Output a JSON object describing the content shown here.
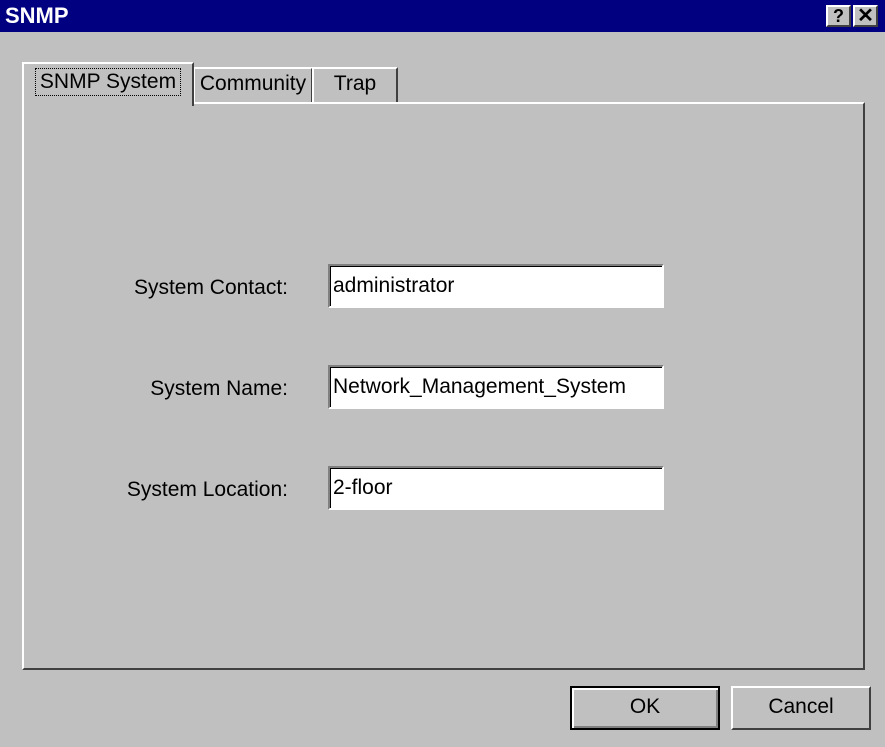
{
  "window": {
    "title": "SNMP",
    "help_glyph": "?",
    "close_glyph": "✕"
  },
  "tabs": [
    {
      "label": "SNMP System",
      "active": true
    },
    {
      "label": "Community",
      "active": false
    },
    {
      "label": "Trap",
      "active": false
    }
  ],
  "fields": {
    "contact": {
      "label": "System Contact:",
      "value": "administrator"
    },
    "name": {
      "label": "System Name:",
      "value": "Network_Management_System"
    },
    "location": {
      "label": "System Location:",
      "value": "2-floor"
    }
  },
  "buttons": {
    "ok": "OK",
    "cancel": "Cancel"
  },
  "colors": {
    "titlebar": "#000080",
    "face": "#c0c0c0"
  }
}
